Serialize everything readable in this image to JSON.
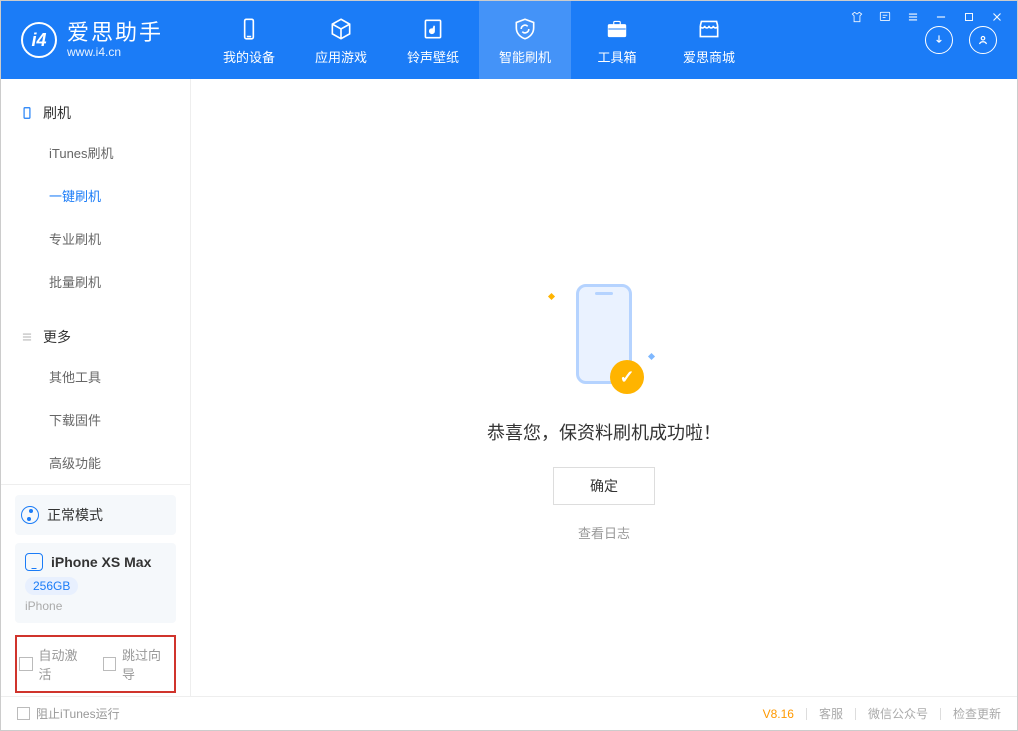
{
  "header": {
    "logo_title": "爱思助手",
    "logo_url": "www.i4.cn",
    "nav": [
      {
        "label": "我的设备"
      },
      {
        "label": "应用游戏"
      },
      {
        "label": "铃声壁纸"
      },
      {
        "label": "智能刷机"
      },
      {
        "label": "工具箱"
      },
      {
        "label": "爱思商城"
      }
    ]
  },
  "sidebar": {
    "section1_title": "刷机",
    "section1_items": [
      "iTunes刷机",
      "一键刷机",
      "专业刷机",
      "批量刷机"
    ],
    "section2_title": "更多",
    "section2_items": [
      "其他工具",
      "下载固件",
      "高级功能"
    ],
    "mode": "正常模式",
    "device": {
      "name": "iPhone XS Max",
      "capacity": "256GB",
      "type": "iPhone"
    },
    "opt1": "自动激活",
    "opt2": "跳过向导"
  },
  "content": {
    "success_text": "恭喜您，保资料刷机成功啦！",
    "ok_button": "确定",
    "log_link": "查看日志"
  },
  "footer": {
    "block_itunes": "阻止iTunes运行",
    "version": "V8.16",
    "link1": "客服",
    "link2": "微信公众号",
    "link3": "检查更新"
  }
}
